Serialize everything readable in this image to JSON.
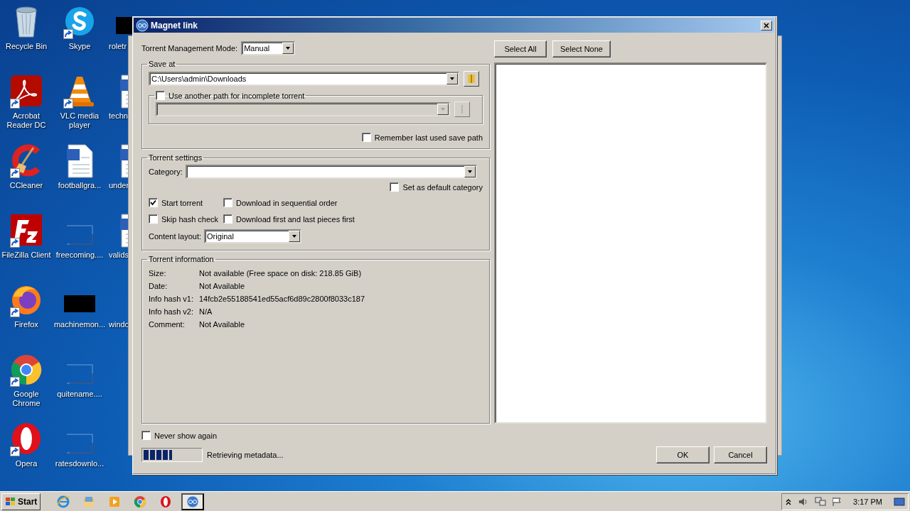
{
  "desktop_icons": [
    {
      "label": "Recycle Bin",
      "kind": "recycle",
      "shortcut": false
    },
    {
      "label": "Acrobat Reader DC",
      "kind": "acrobat",
      "shortcut": true
    },
    {
      "label": "CCleaner",
      "kind": "ccleaner",
      "shortcut": true
    },
    {
      "label": "FileZilla Client",
      "kind": "filezilla",
      "shortcut": true
    },
    {
      "label": "Firefox",
      "kind": "firefox",
      "shortcut": true
    },
    {
      "label": "Google Chrome",
      "kind": "chrome",
      "shortcut": true
    },
    {
      "label": "Opera",
      "kind": "opera",
      "shortcut": true
    },
    {
      "label": "Skype",
      "kind": "skype",
      "shortcut": true
    },
    {
      "label": "VLC media player",
      "kind": "vlc",
      "shortcut": true
    },
    {
      "label": "footballgra...",
      "kind": "word",
      "shortcut": false
    },
    {
      "label": "freecoming....",
      "kind": "blank",
      "shortcut": false
    },
    {
      "label": "machinemon...",
      "kind": "black",
      "shortcut": false
    },
    {
      "label": "quitename....",
      "kind": "blank",
      "shortcut": false
    },
    {
      "label": "ratesdownlo...",
      "kind": "blank",
      "shortcut": false
    },
    {
      "label": "roletr",
      "kind": "black",
      "shortcut": false
    },
    {
      "label": "techn",
      "kind": "word",
      "shortcut": false
    },
    {
      "label": "under",
      "kind": "word",
      "shortcut": false
    },
    {
      "label": "valids",
      "kind": "word",
      "shortcut": false
    },
    {
      "label": "windo",
      "kind": "none",
      "shortcut": false
    }
  ],
  "dialog": {
    "title": "Magnet link",
    "management_mode": {
      "label": "Torrent Management Mode:",
      "value": "Manual"
    },
    "save_at": {
      "title": "Save at",
      "path": "C:\\Users\\admin\\Downloads",
      "incomplete": {
        "label": "Use another path for incomplete torrent",
        "checked": false
      },
      "remember": {
        "label": "Remember last used save path",
        "checked": false
      }
    },
    "torrent_settings": {
      "title": "Torrent settings",
      "category_label": "Category:",
      "default_category": {
        "label": "Set as default category",
        "checked": false
      },
      "options": [
        {
          "label": "Start torrent",
          "checked": true
        },
        {
          "label": "Download in sequential order",
          "checked": false
        },
        {
          "label": "Skip hash check",
          "checked": false
        },
        {
          "label": "Download first and last pieces first",
          "checked": false
        }
      ],
      "content_layout": {
        "label": "Content layout:",
        "value": "Original"
      }
    },
    "torrent_information": {
      "title": "Torrent information",
      "rows": [
        {
          "label": "Size:",
          "value": "Not available (Free space on disk: 218.85 GiB)"
        },
        {
          "label": "Date:",
          "value": "Not Available"
        },
        {
          "label": "Info hash v1:",
          "value": "14fcb2e55188541ed55acf6d89c2800f8033c187"
        },
        {
          "label": "Info hash v2:",
          "value": "N/A"
        },
        {
          "label": "Comment:",
          "value": "Not Available"
        }
      ]
    },
    "file_buttons": [
      "Select All",
      "Select None"
    ],
    "never_show": {
      "label": "Never show again",
      "checked": false
    },
    "progress": {
      "level": 0.5,
      "text": "Retrieving metadata..."
    },
    "buttons": [
      "OK",
      "Cancel"
    ]
  },
  "taskbar": {
    "start": "Start",
    "apps": [
      {
        "kind": "ie",
        "selected": false
      },
      {
        "kind": "explorer",
        "selected": false
      },
      {
        "kind": "media",
        "selected": false
      },
      {
        "kind": "chrome",
        "selected": false
      },
      {
        "kind": "opera",
        "selected": false
      },
      {
        "kind": "qbittorrent",
        "selected": true
      }
    ],
    "clock": "3:17 PM"
  }
}
